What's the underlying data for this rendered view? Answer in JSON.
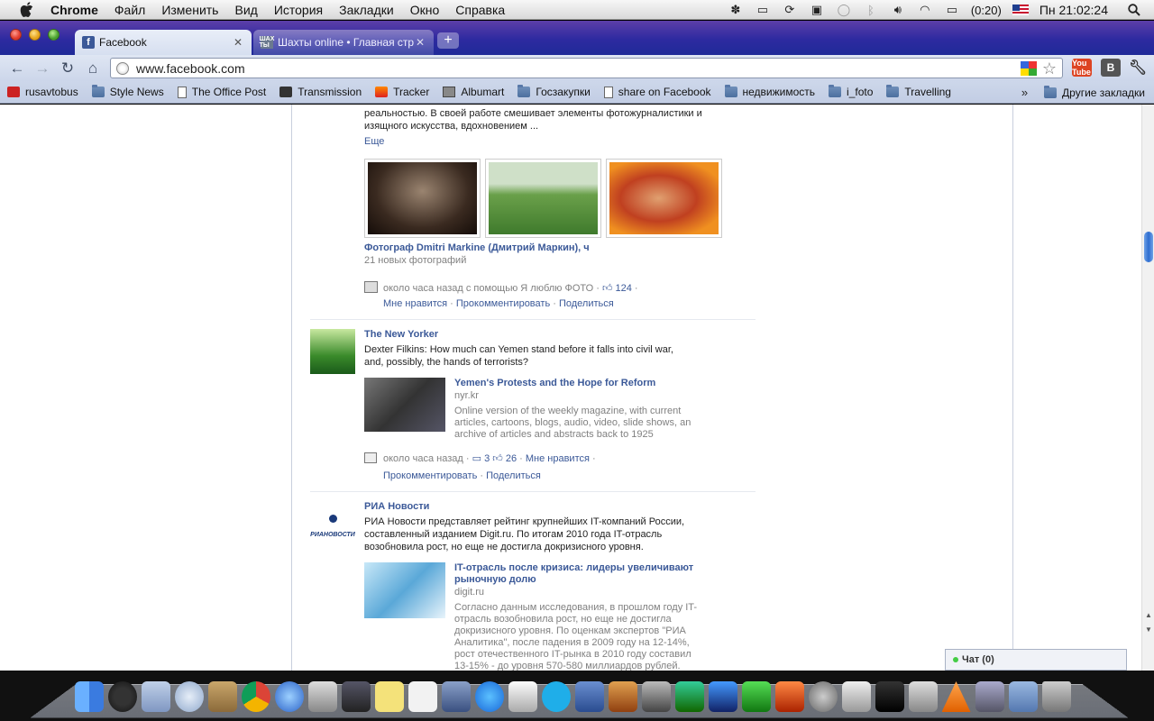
{
  "menubar": {
    "items": [
      "Chrome",
      "Файл",
      "Изменить",
      "Вид",
      "История",
      "Закладки",
      "Окно",
      "Справка"
    ],
    "battery": "(0:20)",
    "clock": "Пн 21:02:24"
  },
  "tabs": [
    {
      "title": "Facebook",
      "favicon": "facebook-icon"
    },
    {
      "title": "Шахты online • Главная стр",
      "favicon_text": "ШАХ ТЫ"
    }
  ],
  "toolbar": {
    "url": "www.facebook.com",
    "yt_label": "You Tube",
    "vk_label": "B"
  },
  "bookmarks": {
    "items": [
      {
        "label": "rusavtobus",
        "icon": "red"
      },
      {
        "label": "Style News",
        "icon": "folder"
      },
      {
        "label": "The Office Post",
        "icon": "page"
      },
      {
        "label": "Transmission",
        "icon": "dark"
      },
      {
        "label": "Tracker",
        "icon": "fire"
      },
      {
        "label": "Albumart",
        "icon": "gray"
      },
      {
        "label": "Госзакупки",
        "icon": "folder"
      },
      {
        "label": "share on Facebook",
        "icon": "page"
      },
      {
        "label": "недвижимость",
        "icon": "folder"
      },
      {
        "label": "i_foto",
        "icon": "folder"
      },
      {
        "label": "Travelling",
        "icon": "folder"
      }
    ],
    "other": "Другие закладки"
  },
  "feed": {
    "post1": {
      "text_line1": "реальностью. В своей работе смешивает элементы фотожурналистики и",
      "text_line2": "изящного искусства, вдохновением ...",
      "more": "Еще",
      "album_title": "Фотограф Dmitri Markine (Дмитрий Маркин), ч",
      "album_sub": "21 новых фотографий",
      "time": "около часа назад с помощью Я люблю ФОТО",
      "likes": "124",
      "like": "Мне нравится",
      "comment": "Прокомментировать",
      "share": "Поделиться"
    },
    "post2": {
      "author": "The New Yorker",
      "text_line1": "Dexter Filkins: How much can Yemen stand before it falls into civil war,",
      "text_line2": "and, possibly, the hands of terrorists?",
      "link_title": "Yemen's Protests and the Hope for Reform",
      "link_domain": "nyr.kr",
      "desc_line1": "Online version of the weekly magazine, with current",
      "desc_line2": "articles, cartoons, blogs, audio, video, slide shows, an",
      "desc_line3": "archive of articles and abstracts back to 1925",
      "time": "около часа назад",
      "comments": "3",
      "likes": "26",
      "like": "Мне нравится",
      "comment": "Прокомментировать",
      "share": "Поделиться"
    },
    "post3": {
      "author": "РИА Новости",
      "avatar_text": "РИАНОВОСТИ",
      "text_line1": "РИА Новости представляет рейтинг крупнейших IT-компаний России,",
      "text_line2": "составленный изданием Digit.ru. По итогам 2010 года IT-отрасль",
      "text_line3": "возобновила рост, но еще не достигла докризисного уровня.",
      "link_title_line1": "IT-отрасль после кризиса: лидеры увеличивают",
      "link_title_line2": "рыночную долю",
      "link_domain": "digit.ru",
      "desc_line1": "Согласно данным исследования, в прошлом году IT-",
      "desc_line2": "отрасль возобновила рост, но еще не достигла",
      "desc_line3": "докризисного уровня. По оценкам экспертов \"РИА",
      "desc_line4": "Аналитика\", после падения в 2009 году на 12-14%,",
      "desc_line5": "рост отечественного IT-рынка в 2010 году составил",
      "desc_line6": "13-15% - до уровня 570-580 миллиардов рублей."
    }
  },
  "chat": {
    "label": "Чат (0)"
  }
}
